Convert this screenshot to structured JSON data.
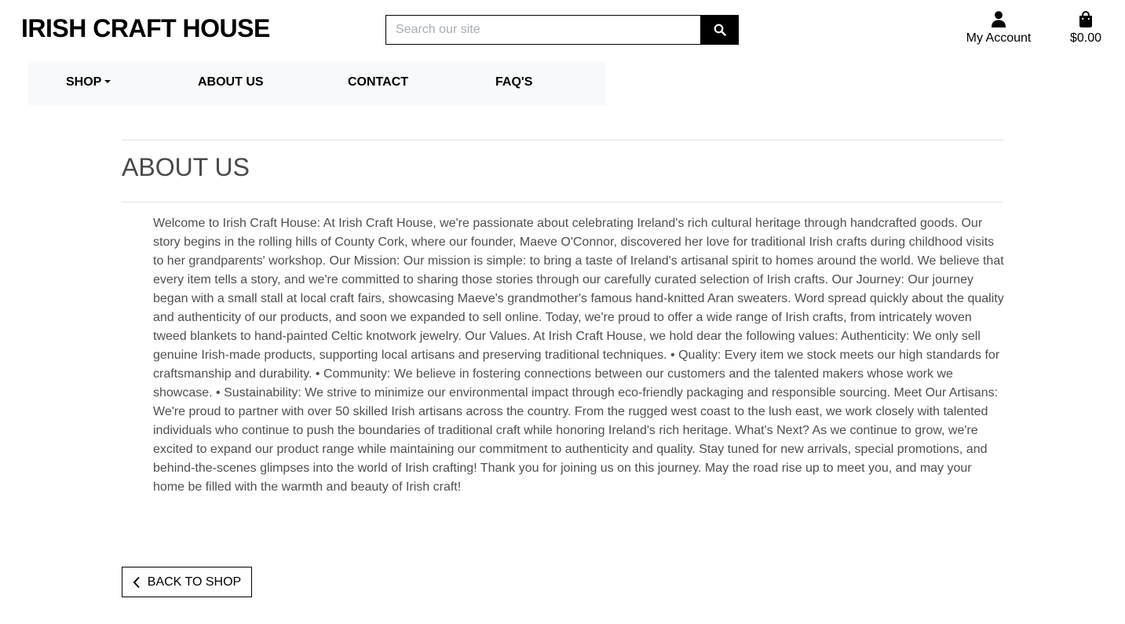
{
  "header": {
    "logo": "IRISH CRAFT HOUSE",
    "search": {
      "placeholder": "Search our site",
      "value": ""
    },
    "account_label": "My Account",
    "bag_total": "$0.00"
  },
  "nav": {
    "items": [
      {
        "label": "SHOP",
        "has_dropdown": true
      },
      {
        "label": "ABOUT US",
        "has_dropdown": false
      },
      {
        "label": "CONTACT",
        "has_dropdown": false
      },
      {
        "label": "FAQ'S",
        "has_dropdown": false
      }
    ]
  },
  "page": {
    "title": "ABOUT US",
    "body": "Welcome to Irish Craft House: At Irish Craft House, we're passionate about celebrating Ireland's rich cultural heritage through handcrafted goods. Our story begins in the rolling hills of County Cork, where our founder, Maeve O'Connor, discovered her love for traditional Irish crafts during childhood visits to her grandparents' workshop. Our Mission: Our mission is simple: to bring a taste of Ireland's artisanal spirit to homes around the world. We believe that every item tells a story, and we're committed to sharing those stories through our carefully curated selection of Irish crafts. Our Journey: Our journey began with a small stall at local craft fairs, showcasing Maeve's grandmother's famous hand-knitted Aran sweaters. Word spread quickly about the quality and authenticity of our products, and soon we expanded to sell online. Today, we're proud to offer a wide range of Irish crafts, from intricately woven tweed blankets to hand-painted Celtic knotwork jewelry. Our Values. At Irish Craft House, we hold dear the following values: Authenticity: We only sell genuine Irish-made products, supporting local artisans and preserving traditional techniques. • Quality: Every item we stock meets our high standards for craftsmanship and durability. • Community: We believe in fostering connections between our customers and the talented makers whose work we showcase. • Sustainability: We strive to minimize our environmental impact through eco-friendly packaging and responsible sourcing. Meet Our Artisans: We're proud to partner with over 50 skilled Irish artisans across the country. From the rugged west coast to the lush east, we work closely with talented individuals who continue to push the boundaries of traditional craft while honoring Ireland's rich heritage. What's Next? As we continue to grow, we're excited to expand our product range while maintaining our commitment to authenticity and quality. Stay tuned for new arrivals, special promotions, and behind-the-scenes glimpses into the world of Irish crafting! Thank you for joining us on this journey. May the road rise up to meet you, and may your home be filled with the warmth and beauty of Irish craft!",
    "back_button_label": "BACK TO SHOP"
  },
  "icons": {
    "search": "search-icon",
    "account": "user-icon",
    "bag": "shopping-bag-icon",
    "back": "chevron-left-icon",
    "shop_dropdown": "caret-down-icon"
  },
  "colors": {
    "primary": "#000000",
    "nav_background": "#f8f9fa",
    "body_text": "#4f4f4f",
    "title_text": "#4a4a4a",
    "placeholder": "#a7adb4"
  }
}
